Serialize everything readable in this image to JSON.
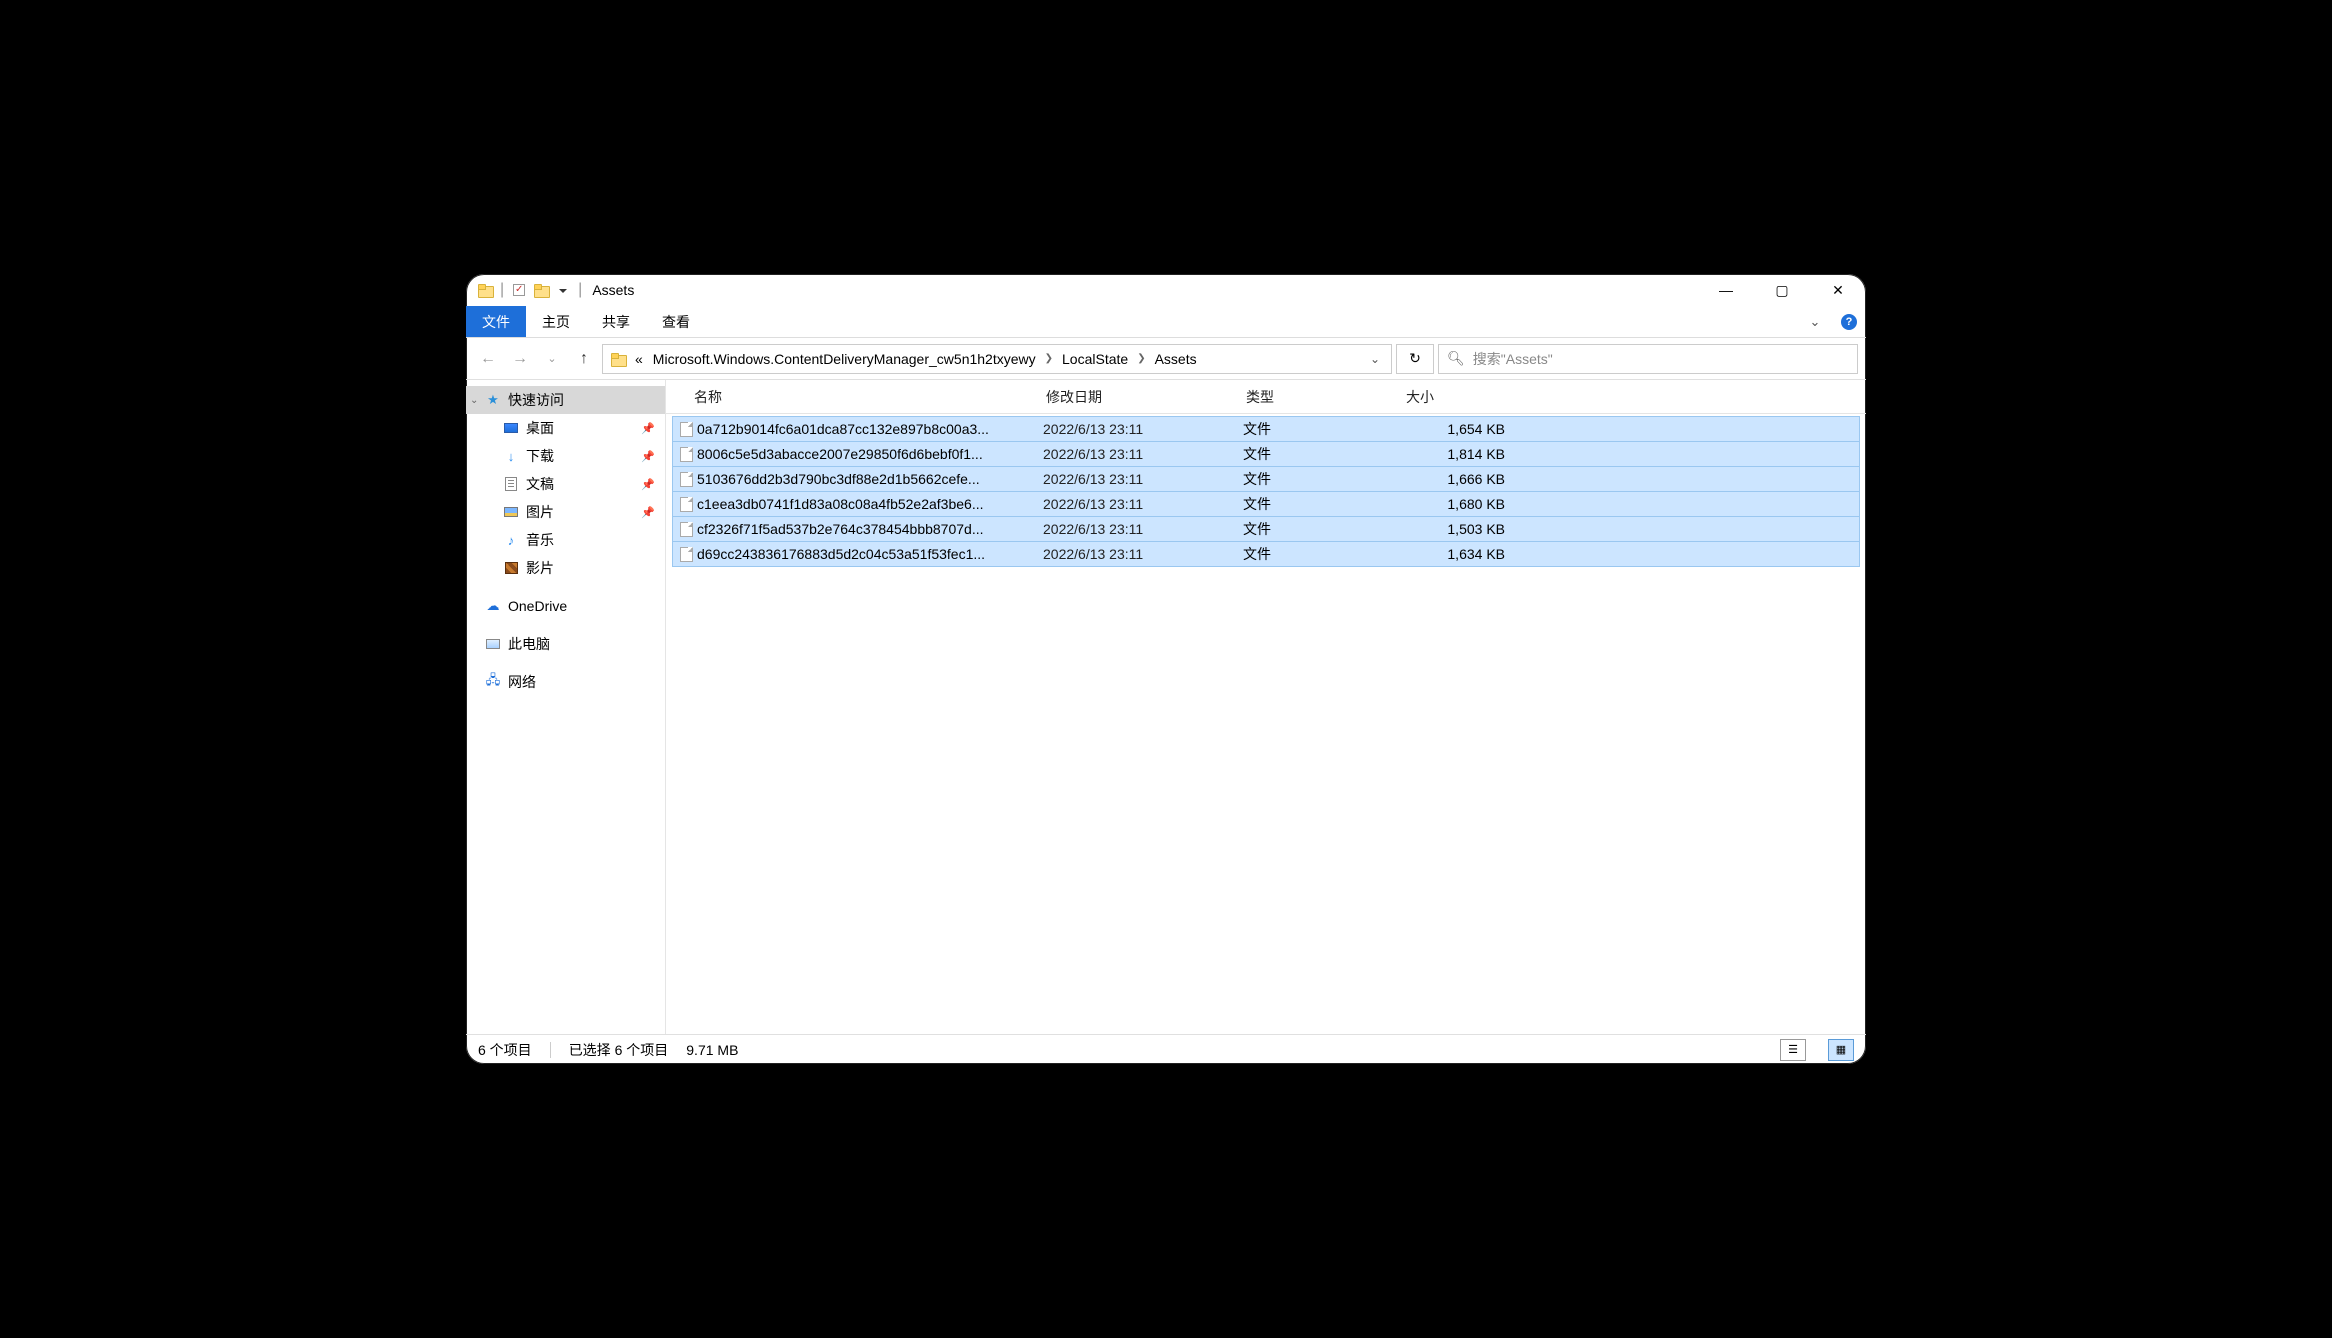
{
  "title": {
    "text": "Assets",
    "separator": "|"
  },
  "ribbon": {
    "file": "文件",
    "home": "主页",
    "share": "共享",
    "view": "查看"
  },
  "breadcrumb": {
    "prefix": "«",
    "segments": [
      "Microsoft.Windows.ContentDeliveryManager_cw5n1h2txyewy",
      "LocalState",
      "Assets"
    ]
  },
  "search": {
    "placeholder": "搜索\"Assets\""
  },
  "sidebar": {
    "quick_access": "快速访问",
    "desktop": "桌面",
    "downloads": "下载",
    "documents": "文稿",
    "pictures": "图片",
    "music": "音乐",
    "videos": "影片",
    "onedrive": "OneDrive",
    "this_pc": "此电脑",
    "network": "网络"
  },
  "columns": {
    "name": "名称",
    "date": "修改日期",
    "type": "类型",
    "size": "大小"
  },
  "files": [
    {
      "name": "0a712b9014fc6a01dca87cc132e897b8c00a3...",
      "date": "2022/6/13 23:11",
      "type": "文件",
      "size": "1,654 KB"
    },
    {
      "name": "8006c5e5d3abacce2007e29850f6d6bebf0f1...",
      "date": "2022/6/13 23:11",
      "type": "文件",
      "size": "1,814 KB"
    },
    {
      "name": "5103676dd2b3d790bc3df88e2d1b5662cefe...",
      "date": "2022/6/13 23:11",
      "type": "文件",
      "size": "1,666 KB"
    },
    {
      "name": "c1eea3db0741f1d83a08c08a4fb52e2af3be6...",
      "date": "2022/6/13 23:11",
      "type": "文件",
      "size": "1,680 KB"
    },
    {
      "name": "cf2326f71f5ad537b2e764c378454bbb8707d...",
      "date": "2022/6/13 23:11",
      "type": "文件",
      "size": "1,503 KB"
    },
    {
      "name": "d69cc243836176883d5d2c04c53a51f53fec1...",
      "date": "2022/6/13 23:11",
      "type": "文件",
      "size": "1,634 KB"
    }
  ],
  "status": {
    "count": "6 个项目",
    "selection": "已选择 6 个项目",
    "size": "9.71 MB"
  }
}
